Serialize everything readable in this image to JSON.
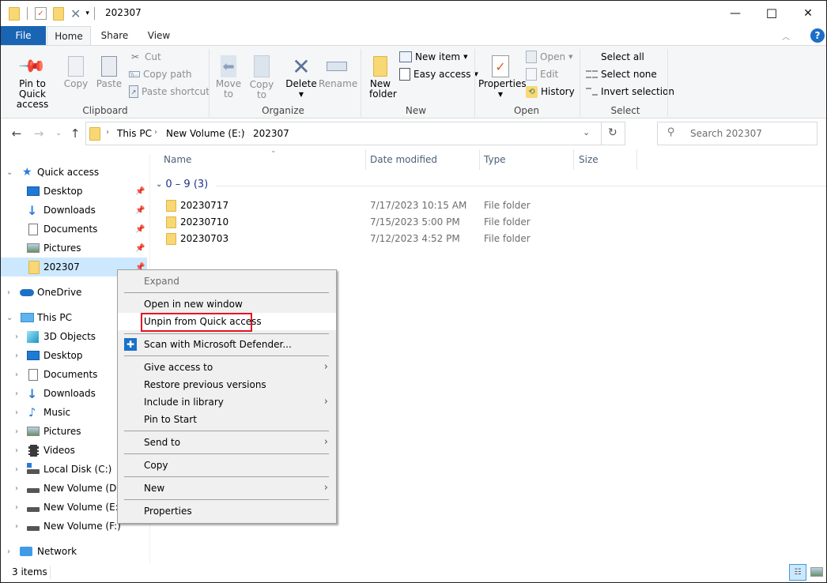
{
  "window": {
    "title": "202307",
    "controls": {
      "minimize": "—",
      "maximize": "☐",
      "close": "✕"
    }
  },
  "ribbon_tabs": [
    {
      "label": "File",
      "active": false
    },
    {
      "label": "Home",
      "active": true
    },
    {
      "label": "Share",
      "active": false
    },
    {
      "label": "View",
      "active": false
    }
  ],
  "ribbon": {
    "clipboard": {
      "label": "Clipboard",
      "pin_to_quick_access": "Pin to Quick access",
      "copy": "Copy",
      "paste": "Paste",
      "cut": "Cut",
      "copy_path": "Copy path",
      "paste_shortcut": "Paste shortcut"
    },
    "organize": {
      "label": "Organize",
      "move_to": "Move to",
      "copy_to": "Copy to",
      "delete": "Delete",
      "rename": "Rename"
    },
    "new": {
      "label": "New",
      "new_folder": "New folder",
      "new_item": "New item",
      "easy_access": "Easy access"
    },
    "open": {
      "label": "Open",
      "properties": "Properties",
      "open": "Open",
      "edit": "Edit",
      "history": "History"
    },
    "select": {
      "label": "Select",
      "select_all": "Select all",
      "select_none": "Select none",
      "invert_selection": "Invert selection"
    }
  },
  "address": {
    "breadcrumbs": [
      "This PC",
      "New Volume (E:)",
      "202307"
    ],
    "search_placeholder": "Search 202307"
  },
  "nav_pane": {
    "quick_access": {
      "label": "Quick access",
      "items": [
        {
          "label": "Desktop",
          "pinned": true
        },
        {
          "label": "Downloads",
          "pinned": true
        },
        {
          "label": "Documents",
          "pinned": true
        },
        {
          "label": "Pictures",
          "pinned": true
        },
        {
          "label": "202307",
          "pinned": true,
          "selected": true
        }
      ]
    },
    "onedrive": "OneDrive",
    "this_pc": {
      "label": "This PC",
      "items": [
        "3D Objects",
        "Desktop",
        "Documents",
        "Downloads",
        "Music",
        "Pictures",
        "Videos",
        "Local Disk (C:)",
        "New Volume (D:)",
        "New Volume (E:)",
        "New Volume (F:)"
      ]
    },
    "network": "Network"
  },
  "file_list": {
    "columns": [
      "Name",
      "Date modified",
      "Type",
      "Size"
    ],
    "group": "0 – 9 (3)",
    "rows": [
      {
        "name": "20230717",
        "date": "7/17/2023 10:15 AM",
        "type": "File folder",
        "size": ""
      },
      {
        "name": "20230710",
        "date": "7/15/2023 5:00 PM",
        "type": "File folder",
        "size": ""
      },
      {
        "name": "20230703",
        "date": "7/12/2023 4:52 PM",
        "type": "File folder",
        "size": ""
      }
    ]
  },
  "context_menu": {
    "items": [
      {
        "label": "Expand",
        "disabled": true
      },
      {
        "label": "Open in new window"
      },
      {
        "label": "Unpin from Quick access",
        "highlighted": true
      },
      {
        "label": "Scan with Microsoft Defender..."
      },
      {
        "label": "Give access to",
        "submenu": true
      },
      {
        "label": "Restore previous versions"
      },
      {
        "label": "Include in library",
        "submenu": true
      },
      {
        "label": "Pin to Start"
      },
      {
        "label": "Send to",
        "submenu": true
      },
      {
        "label": "Copy"
      },
      {
        "label": "New",
        "submenu": true
      },
      {
        "label": "Properties"
      }
    ],
    "highlight_color": "#e81123"
  },
  "status_bar": {
    "item_count": "3 items"
  },
  "colors": {
    "file_tab": "#1a64b4",
    "selection": "#cce8ff",
    "folder": "#f8d775"
  }
}
